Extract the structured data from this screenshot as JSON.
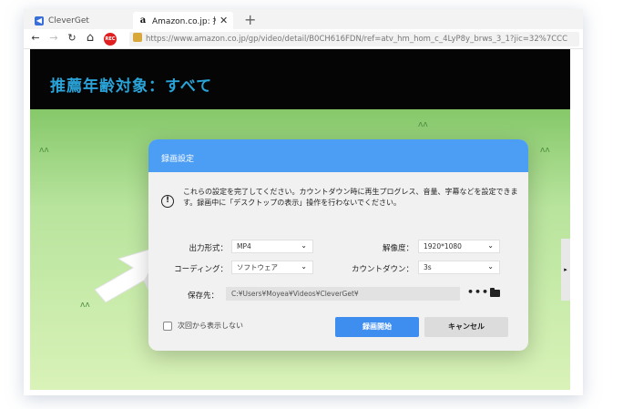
{
  "browser": {
    "tabs": [
      {
        "label": "CleverGet",
        "icon": "cleverget-icon"
      },
      {
        "label": "Amazon.co.jp: 推薦年齢",
        "icon": "amazon-icon",
        "close": "✕"
      }
    ],
    "new_tab": "+",
    "nav": {
      "back": "←",
      "forward": "→",
      "reload": "↻",
      "home": "⌂",
      "rec": "REC"
    },
    "url": "https://www.amazon.co.jp/gp/video/detail/B0CH616FDN/ref=atv_hm_hom_c_4LyP8y_brws_3_1?jic=32%7CCC"
  },
  "page": {
    "hero_text": "推薦年齢対象：すべて",
    "scroll_arrow": "▸"
  },
  "dialog": {
    "title": "録画設定",
    "message": "これらの設定を完了してください。カウントダウン時に再生プログレス、音量、字幕などを設定できます。録画中に「デスクトップの表示」操作を行わないでください。",
    "fields": {
      "format_label": "出力形式：",
      "format_value": "MP4",
      "resolution_label": "解像度：",
      "resolution_value": "1920*1080",
      "encoding_label": "コーディング：",
      "encoding_value": "ソフトウェア",
      "countdown_label": "カウントダウン：",
      "countdown_value": "3s",
      "save_label": "保存先：",
      "save_path": "C:¥Users¥Moyea¥Videos¥CleverGet¥"
    },
    "more_button": "•••",
    "dont_show_label": "次回から表示しない",
    "start_button": "録画開始",
    "cancel_button": "キャンセル"
  },
  "colors": {
    "dialog_header": "#4c9df4",
    "primary_button": "#3e8ef0",
    "hero_text": "#2aa3d8"
  }
}
